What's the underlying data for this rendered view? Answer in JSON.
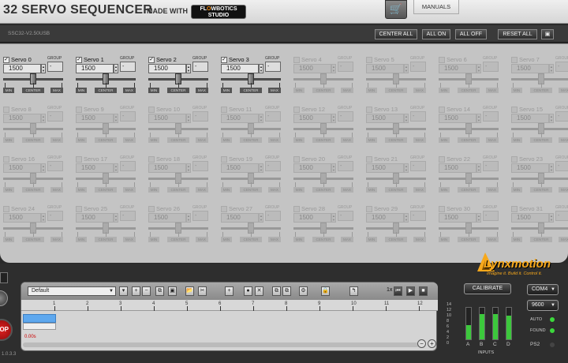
{
  "header": {
    "title": "32 SERVO SEQUENCER",
    "made_with": "MADE WITH",
    "logo_line1": "FL",
    "logo_o": "O",
    "logo_line1b": "WBOTICS",
    "logo_line2": "STUDIO",
    "cart_icon": "cart-icon",
    "manuals": "MANUALS"
  },
  "toolbar": {
    "firmware": "SSC32-V2.50USB",
    "center_all": "CENTER ALL",
    "all_on": "ALL ON",
    "all_off": "ALL OFF",
    "reset_all": "RESET ALL",
    "save_icon": "floppy-icon"
  },
  "servo_defaults": {
    "value": "1500",
    "group_label": "GROUP",
    "group_value": "-",
    "min": "MIN",
    "center": "CENTER",
    "max": "MAX"
  },
  "servos": [
    {
      "name": "Servo 0",
      "enabled": true
    },
    {
      "name": "Servo 1",
      "enabled": true
    },
    {
      "name": "Servo 2",
      "enabled": true
    },
    {
      "name": "Servo 3",
      "enabled": true
    },
    {
      "name": "Servo 4",
      "enabled": false
    },
    {
      "name": "Servo 5",
      "enabled": false
    },
    {
      "name": "Servo 6",
      "enabled": false
    },
    {
      "name": "Servo 7",
      "enabled": false
    },
    {
      "name": "Servo 8",
      "enabled": false
    },
    {
      "name": "Servo 9",
      "enabled": false
    },
    {
      "name": "Servo 10",
      "enabled": false
    },
    {
      "name": "Servo 11",
      "enabled": false
    },
    {
      "name": "Servo 12",
      "enabled": false
    },
    {
      "name": "Servo 13",
      "enabled": false
    },
    {
      "name": "Servo 14",
      "enabled": false
    },
    {
      "name": "Servo 15",
      "enabled": false
    },
    {
      "name": "Servo 16",
      "enabled": false
    },
    {
      "name": "Servo 17",
      "enabled": false
    },
    {
      "name": "Servo 18",
      "enabled": false
    },
    {
      "name": "Servo 19",
      "enabled": false
    },
    {
      "name": "Servo 20",
      "enabled": false
    },
    {
      "name": "Servo 21",
      "enabled": false
    },
    {
      "name": "Servo 22",
      "enabled": false
    },
    {
      "name": "Servo 23",
      "enabled": false
    },
    {
      "name": "Servo 24",
      "enabled": false
    },
    {
      "name": "Servo 25",
      "enabled": false
    },
    {
      "name": "Servo 26",
      "enabled": false
    },
    {
      "name": "Servo 27",
      "enabled": false
    },
    {
      "name": "Servo 28",
      "enabled": false
    },
    {
      "name": "Servo 29",
      "enabled": false
    },
    {
      "name": "Servo 30",
      "enabled": false
    },
    {
      "name": "Servo 31",
      "enabled": false
    }
  ],
  "sequencer": {
    "sequence_name": "Default",
    "speed": "1x",
    "elapsed": "0.00s",
    "ruler": [
      "1",
      "2",
      "3",
      "4",
      "5",
      "6",
      "7",
      "8",
      "9",
      "10",
      "11",
      "12"
    ],
    "buttons": [
      "▾",
      "+",
      "−",
      "⧉",
      "▣",
      "📂",
      "✂",
      "+",
      "●",
      "✕",
      "⧉",
      "⧉",
      "⚙",
      "🔒",
      "↰",
      "⏮",
      "▶",
      "■"
    ]
  },
  "side_left": {
    "stop": "OP",
    "version": "1.0.3.3"
  },
  "brand": {
    "name": "Lynxmotion",
    "tagline": "Imagine it. Build it. Control it."
  },
  "controls": {
    "calibrate": "CALIBRATE",
    "port": "COM4",
    "baud": "9600",
    "auto": "AUTO",
    "found": "FOUND",
    "ps2": "PS2"
  },
  "meters": {
    "scale": [
      "14",
      "12",
      "10",
      "8",
      "6",
      "4",
      "2",
      "0"
    ],
    "channels": [
      "A",
      "B",
      "C",
      "D"
    ],
    "levels": [
      0.45,
      0.8,
      0.8,
      0.75
    ],
    "label": "INPUTS"
  }
}
